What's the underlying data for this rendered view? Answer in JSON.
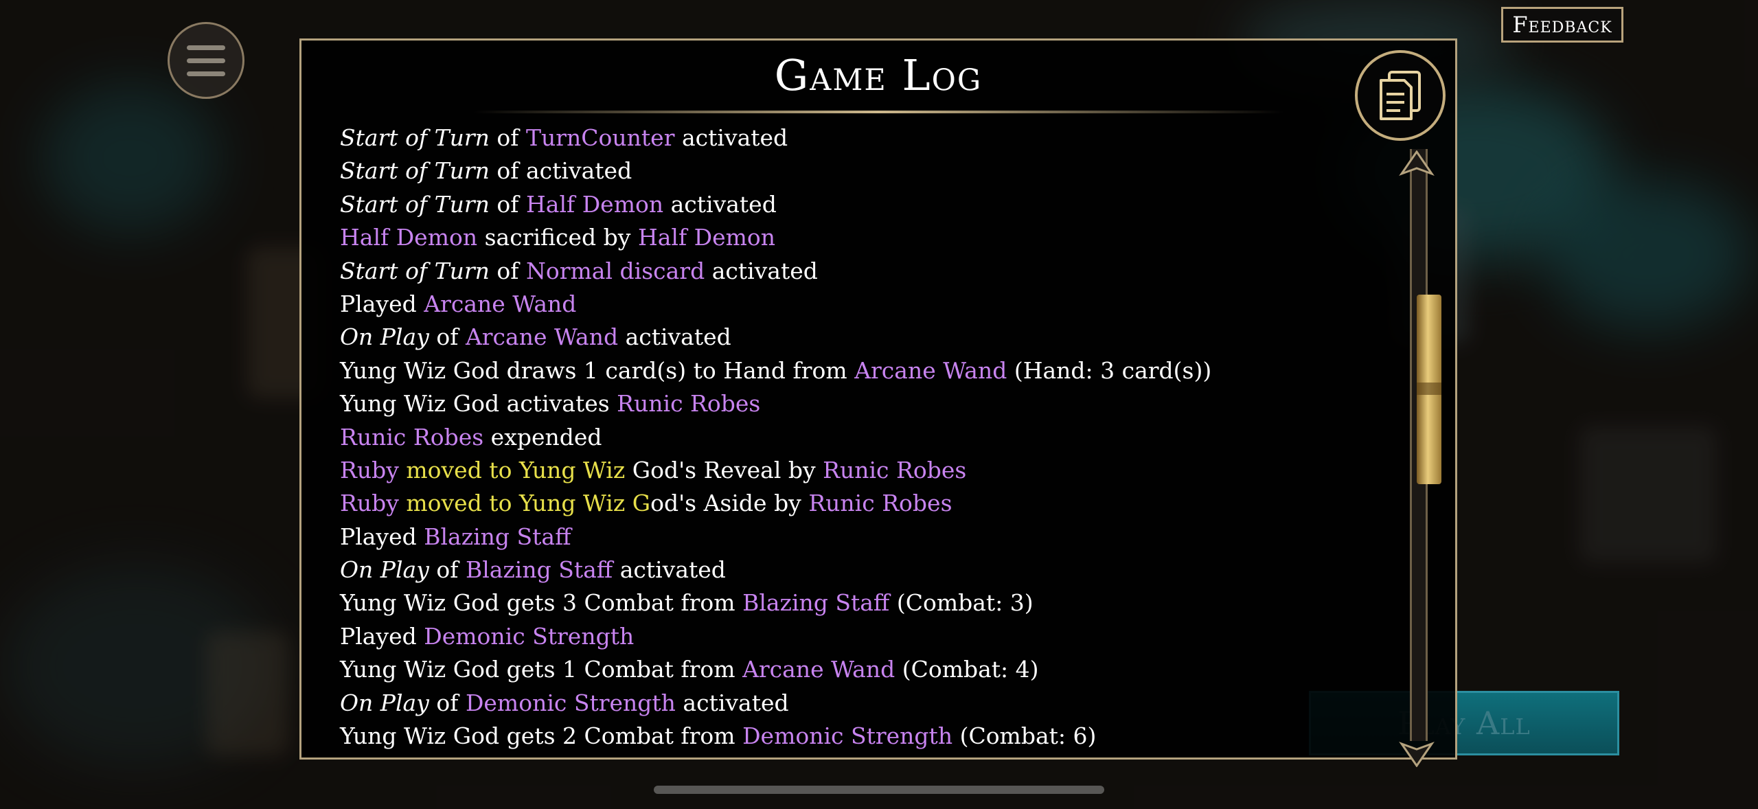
{
  "header": {
    "feedback_label": "Feedback"
  },
  "game_log": {
    "title": "Game Log",
    "entries": [
      [
        {
          "t": "Start of Turn",
          "c": "it"
        },
        {
          "t": " of "
        },
        {
          "t": "TurnCounter",
          "c": "p"
        },
        {
          "t": " activated"
        }
      ],
      [
        {
          "t": "Start of Turn",
          "c": "it"
        },
        {
          "t": " of  activated"
        }
      ],
      [
        {
          "t": "Start of Turn",
          "c": "it"
        },
        {
          "t": " of "
        },
        {
          "t": "Half Demon",
          "c": "p"
        },
        {
          "t": " activated"
        }
      ],
      [
        {
          "t": "Half Demon",
          "c": "p"
        },
        {
          "t": " sacrificed by "
        },
        {
          "t": "Half Demon",
          "c": "p"
        }
      ],
      [
        {
          "t": "Start of Turn",
          "c": "it"
        },
        {
          "t": " of "
        },
        {
          "t": "Normal discard",
          "c": "p"
        },
        {
          "t": " activated"
        }
      ],
      [
        {
          "t": "Played "
        },
        {
          "t": "Arcane Wand",
          "c": "p"
        }
      ],
      [
        {
          "t": "On Play",
          "c": "it"
        },
        {
          "t": " of "
        },
        {
          "t": "Arcane Wand",
          "c": "p"
        },
        {
          "t": " activated"
        }
      ],
      [
        {
          "t": "Yung Wiz God draws 1 card(s) to Hand from "
        },
        {
          "t": "Arcane Wand",
          "c": "p"
        },
        {
          "t": " (Hand: 3 card(s))"
        }
      ],
      [
        {
          "t": "Yung Wiz God activates "
        },
        {
          "t": "Runic Robes",
          "c": "p"
        }
      ],
      [
        {
          "t": "Runic Robes",
          "c": "p"
        },
        {
          "t": " expended"
        }
      ],
      [
        {
          "t": "Ruby",
          "c": "p"
        },
        {
          "t": " moved to Yung Wiz",
          "c": "y"
        },
        {
          "t": " God's Reveal by "
        },
        {
          "t": "Runic Robes",
          "c": "p"
        }
      ],
      [
        {
          "t": "Ruby",
          "c": "p"
        },
        {
          "t": " moved to Yung Wiz G",
          "c": "y"
        },
        {
          "t": "od's Aside by "
        },
        {
          "t": "Runic Robes",
          "c": "p"
        }
      ],
      [
        {
          "t": "Played "
        },
        {
          "t": "Blazing Staff",
          "c": "p"
        }
      ],
      [
        {
          "t": "On Play",
          "c": "it"
        },
        {
          "t": " of "
        },
        {
          "t": "Blazing Staff",
          "c": "p"
        },
        {
          "t": " activated"
        }
      ],
      [
        {
          "t": "Yung Wiz God gets 3 Combat from "
        },
        {
          "t": "Blazing Staff",
          "c": "p"
        },
        {
          "t": " (Combat: 3)"
        }
      ],
      [
        {
          "t": "Played "
        },
        {
          "t": "Demonic Strength",
          "c": "p"
        }
      ],
      [
        {
          "t": "Yung Wiz God gets 1 Combat from "
        },
        {
          "t": "Arcane Wand",
          "c": "p"
        },
        {
          "t": " (Combat: 4)"
        }
      ],
      [
        {
          "t": "On Play",
          "c": "it"
        },
        {
          "t": " of "
        },
        {
          "t": "Demonic Strength",
          "c": "p"
        },
        {
          "t": " activated"
        }
      ],
      [
        {
          "t": "Yung Wiz God gets 2 Combat from "
        },
        {
          "t": "Demonic Strength",
          "c": "p"
        },
        {
          "t": " (Combat: 6)"
        }
      ]
    ]
  },
  "footer": {
    "play_all_label": "Play All"
  },
  "colors": {
    "card_name": "#c884f0",
    "highlight": "#e8e04a",
    "gold_border": "#b4a27e"
  },
  "icons": {
    "menu": "hamburger-menu-icon",
    "copy": "copy-documents-icon"
  }
}
